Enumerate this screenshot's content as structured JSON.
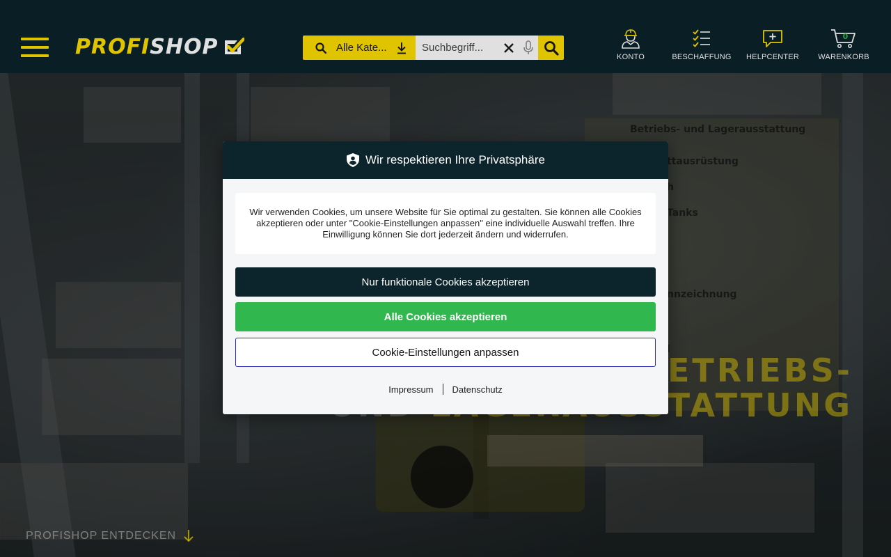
{
  "header": {
    "logo": {
      "part_a": "PROFI",
      "part_b": "SHOP"
    },
    "search": {
      "category_label": "Alle Kate...",
      "placeholder": "Suchbegriff...",
      "value": ""
    },
    "nav": [
      {
        "id": "konto",
        "label": "KONTO",
        "icon": "user-icon"
      },
      {
        "id": "beschaffung",
        "label": "BESCHAFFUNG",
        "icon": "checklist-icon"
      },
      {
        "id": "helpcenter",
        "label": "HELPCENTER",
        "icon": "chat-plus-icon"
      },
      {
        "id": "warenkorb",
        "label": "WARENKORB",
        "icon": "cart-icon",
        "badge": "0"
      }
    ]
  },
  "hero": {
    "sign_lines": [
      "Betriebs- und Lagerausstattung",
      "ttausrüstung",
      "h",
      "Tanks",
      "nnzeichnung",
      "l"
    ],
    "title_line1": "BETRIEBS-",
    "title_line2_dim": "UND ",
    "title_line2": "LAGERAUSSTATTUNG",
    "discover_label": "PROFISHOP ENTDECKEN"
  },
  "modal": {
    "title": "Wir respektieren Ihre Privatsphäre",
    "text": "Wir verwenden Cookies, um unsere Website für Sie optimal zu gestalten. Sie können alle Cookies akzeptieren oder unter \"Cookie-Einstellungen anpassen\" eine individuelle Auswahl treffen. Ihre Einwilligung können Sie dort jederzeit ändern und widerrufen.",
    "btn_functional": "Nur funktionale Cookies akzeptieren",
    "btn_all": "Alle Cookies akzeptieren",
    "btn_settings": "Cookie-Einstellungen anpassen",
    "link_imprint": "Impressum",
    "link_privacy": "Datenschutz"
  },
  "colors": {
    "brand_yellow": "#ffe000",
    "header_bg": "#0c242b",
    "accept_green": "#30b84f",
    "settings_border": "#2b2bb8"
  }
}
